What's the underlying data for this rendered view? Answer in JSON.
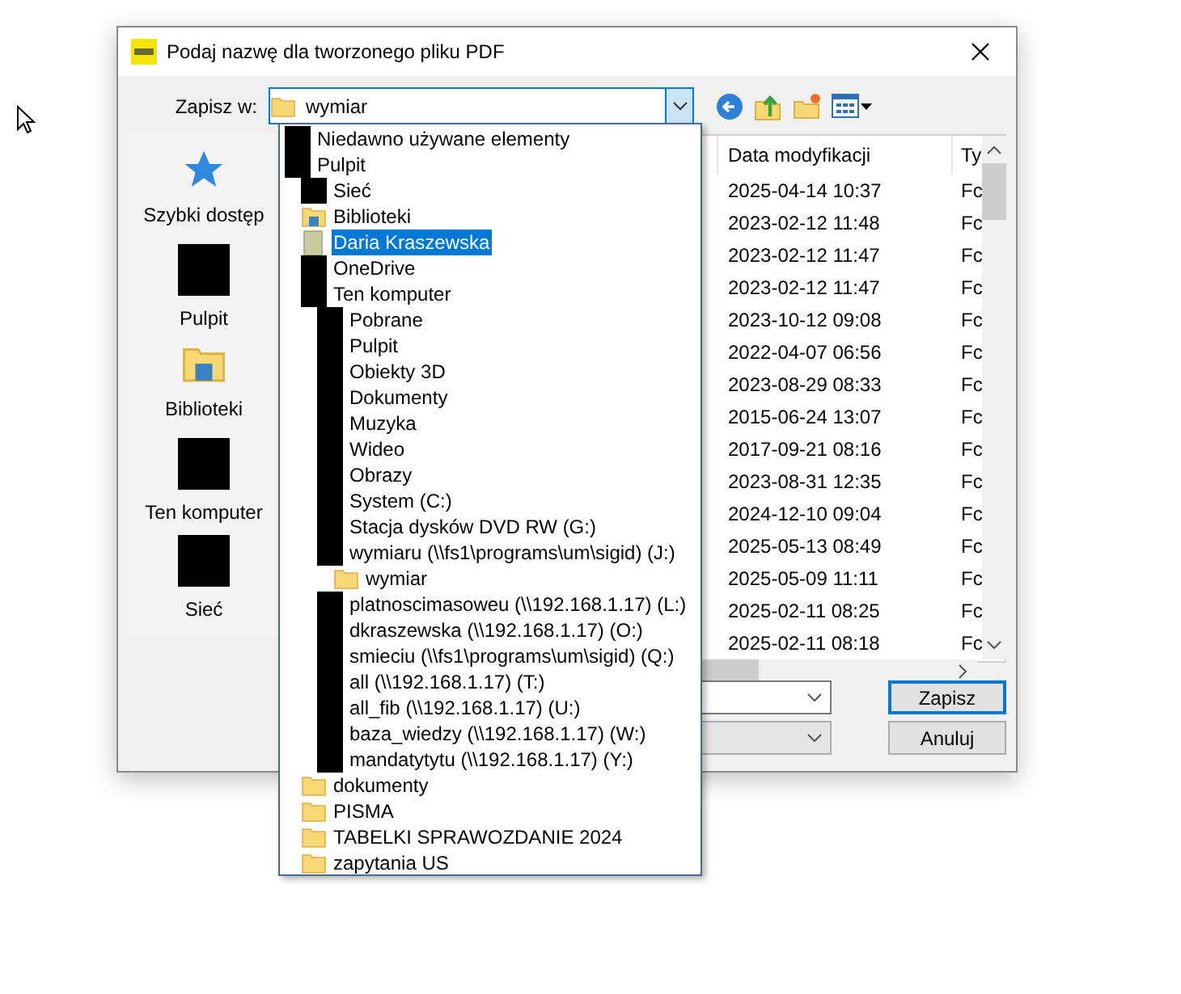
{
  "window": {
    "title": "Podaj nazwę dla tworzonego pliku PDF"
  },
  "save_in": {
    "label": "Zapisz w:",
    "value": "wymiar"
  },
  "places": [
    {
      "label": "Szybki dostęp",
      "kind": "star"
    },
    {
      "label": "Pulpit",
      "kind": "redacted"
    },
    {
      "label": "Biblioteki",
      "kind": "library"
    },
    {
      "label": "Ten komputer",
      "kind": "redacted"
    },
    {
      "label": "Sieć",
      "kind": "redacted"
    }
  ],
  "file_list": {
    "columns": [
      "Data modyfikacji",
      "Ty"
    ],
    "rows": [
      {
        "date": "2025-04-14 10:37",
        "type": "Fc"
      },
      {
        "date": "2023-02-12 11:48",
        "type": "Fc"
      },
      {
        "date": "2023-02-12 11:47",
        "type": "Fc"
      },
      {
        "date": "2023-02-12 11:47",
        "type": "Fc"
      },
      {
        "date": "2023-10-12 09:08",
        "type": "Fc"
      },
      {
        "date": "2022-04-07 06:56",
        "type": "Fc"
      },
      {
        "date": "2023-08-29 08:33",
        "type": "Fc"
      },
      {
        "date": "2015-06-24 13:07",
        "type": "Fc"
      },
      {
        "date": "2017-09-21 08:16",
        "type": "Fc"
      },
      {
        "date": "2023-08-31 12:35",
        "type": "Fc"
      },
      {
        "date": "2024-12-10 09:04",
        "type": "Fc"
      },
      {
        "date": "2025-05-13 08:49",
        "type": "Fc"
      },
      {
        "date": "2025-05-09 11:11",
        "type": "Fc"
      },
      {
        "date": "2025-02-11 08:25",
        "type": "Fc"
      },
      {
        "date": "2025-02-11 08:18",
        "type": "Fc"
      }
    ]
  },
  "buttons": [
    {
      "label": "Zapisz",
      "default": true
    },
    {
      "label": "Anuluj",
      "default": false
    }
  ],
  "dropdown": {
    "items": [
      {
        "label": "Niedawno używane elementy",
        "kind": "redacted",
        "selected": false
      },
      {
        "label": "Pulpit",
        "kind": "redacted",
        "selected": false,
        "children": [
          {
            "label": "Sieć",
            "kind": "redacted",
            "selected": false
          },
          {
            "label": "Biblioteki",
            "kind": "library",
            "selected": false
          },
          {
            "label": "Daria Kraszewska",
            "kind": "user-folder",
            "selected": true
          },
          {
            "label": "OneDrive",
            "kind": "redacted",
            "selected": false
          },
          {
            "label": "Ten komputer",
            "kind": "redacted",
            "selected": false,
            "children": [
              {
                "label": "Pobrane",
                "kind": "redacted",
                "selected": false
              },
              {
                "label": "Pulpit",
                "kind": "redacted",
                "selected": false
              },
              {
                "label": "Obiekty 3D",
                "kind": "redacted",
                "selected": false
              },
              {
                "label": "Dokumenty",
                "kind": "redacted",
                "selected": false
              },
              {
                "label": "Muzyka",
                "kind": "redacted",
                "selected": false
              },
              {
                "label": "Wideo",
                "kind": "redacted",
                "selected": false
              },
              {
                "label": "Obrazy",
                "kind": "redacted",
                "selected": false
              },
              {
                "label": "System (C:)",
                "kind": "redacted",
                "selected": false
              },
              {
                "label": "Stacja dysków DVD RW (G:)",
                "kind": "redacted",
                "selected": false
              },
              {
                "label": "wymiaru (\\\\fs1\\programs\\um\\sigid) (J:)",
                "kind": "redacted",
                "selected": false,
                "children": [
                  {
                    "label": "wymiar",
                    "kind": "folder",
                    "selected": false
                  }
                ]
              },
              {
                "label": "platnoscimasoweu (\\\\192.168.1.17) (L:)",
                "kind": "redacted",
                "selected": false
              },
              {
                "label": "dkraszewska (\\\\192.168.1.17) (O:)",
                "kind": "redacted",
                "selected": false
              },
              {
                "label": "smieciu (\\\\fs1\\programs\\um\\sigid) (Q:)",
                "kind": "redacted",
                "selected": false
              },
              {
                "label": "all (\\\\192.168.1.17) (T:)",
                "kind": "redacted",
                "selected": false
              },
              {
                "label": "all_fib (\\\\192.168.1.17) (U:)",
                "kind": "redacted",
                "selected": false
              },
              {
                "label": "baza_wiedzy (\\\\192.168.1.17) (W:)",
                "kind": "redacted",
                "selected": false
              },
              {
                "label": "mandatytytu (\\\\192.168.1.17) (Y:)",
                "kind": "redacted",
                "selected": false
              }
            ]
          },
          {
            "label": "dokumenty",
            "kind": "folder",
            "selected": false
          },
          {
            "label": "PISMA",
            "kind": "folder",
            "selected": false
          },
          {
            "label": "TABELKI SPRAWOZDANIE 2024",
            "kind": "folder",
            "selected": false
          },
          {
            "label": "zapytania US",
            "kind": "folder",
            "selected": false
          }
        ]
      }
    ]
  }
}
